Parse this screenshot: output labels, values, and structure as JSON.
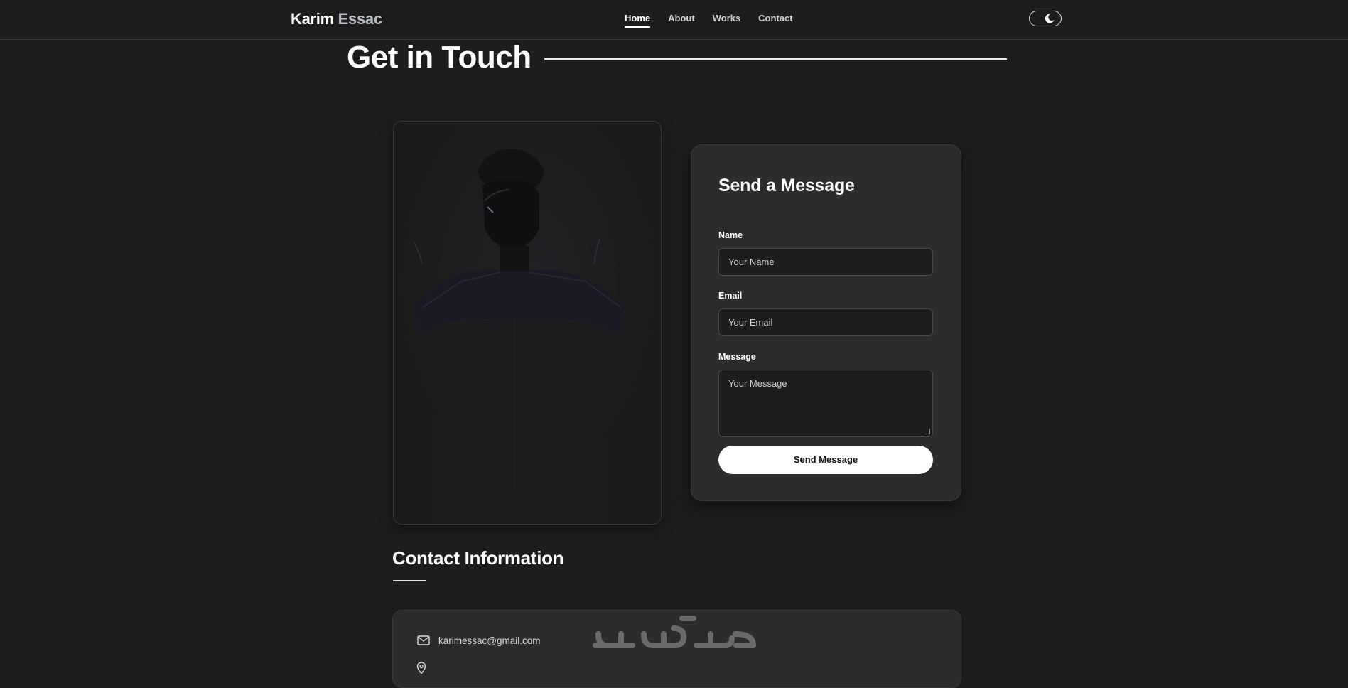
{
  "header": {
    "brand_first": "Karim",
    "brand_last": "Essac",
    "nav": [
      {
        "label": "Home",
        "active": true
      },
      {
        "label": "About",
        "active": false
      },
      {
        "label": "Works",
        "active": false
      },
      {
        "label": "Contact",
        "active": false
      }
    ],
    "theme_toggle_icon": "moon-icon"
  },
  "page": {
    "title": "Get in Touch"
  },
  "form": {
    "title": "Send a Message",
    "name_label": "Name",
    "name_placeholder": "Your Name",
    "email_label": "Email",
    "email_placeholder": "Your Email",
    "message_label": "Message",
    "message_placeholder": "Your Message",
    "submit_label": "Send Message"
  },
  "contact": {
    "title": "Contact Information",
    "email": "karimessac@gmail.com",
    "email_icon": "mail-icon",
    "location_icon": "location-pin-icon"
  },
  "watermark": {
    "text": "خمسات"
  },
  "colors": {
    "background": "#1d1d1d",
    "card": "#2c2c2c",
    "accent": "#ffffff",
    "brand_secondary": "#b9bcc4"
  }
}
